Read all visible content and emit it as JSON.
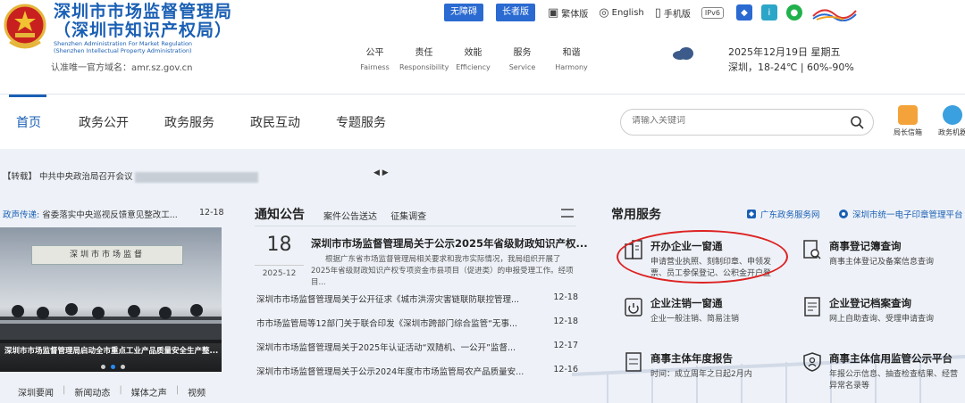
{
  "header": {
    "title_line1": "深圳市市场监督管理局",
    "title_line2": "（深圳市知识产权局）",
    "title_en_line1": "Shenzhen Administration For Market Regulation",
    "title_en_line2": "(Shenzhen Intellectual Property Administration)",
    "domain_label": "认准唯一官方域名：amr.sz.gov.cn",
    "values": [
      {
        "cn": "公平",
        "en": "Fairness"
      },
      {
        "cn": "责任",
        "en": "Responsibility"
      },
      {
        "cn": "效能",
        "en": "Efficiency"
      },
      {
        "cn": "服务",
        "en": "Service"
      },
      {
        "cn": "和谐",
        "en": "Harmony"
      }
    ],
    "date": "2025年12月19日 星期五",
    "weather": "深圳，18-24℃  |  60%-90%"
  },
  "topbar": {
    "accessible_label": "无障碍",
    "elderly_label": "长者版",
    "traditional_label": "繁体版",
    "english_label": "English",
    "mobile_label": "手机版",
    "ipv6_label": "IPv6"
  },
  "nav": {
    "items": [
      "首页",
      "政务公开",
      "政务服务",
      "政民互动",
      "专题服务"
    ],
    "search_placeholder": "请输入关键词",
    "icon1_label": "局长信箱",
    "icon2_label": "政务机器"
  },
  "ticker": {
    "text": "【转载】 中共中央政治局召开会议",
    "arrows": "◀ ▶"
  },
  "left": {
    "news_tag": "政声传递:",
    "news_title": "省委落实中央巡视反馈意见整改工...",
    "news_date": "12-18",
    "photo_sign": "深圳市市场监督",
    "photo_caption": "深圳市市场监督管理局启动全市重点工业产品质量安全生产整...",
    "tabs": [
      "深圳要闻",
      "新闻动态",
      "媒体之声",
      "视频"
    ]
  },
  "notice": {
    "heading": "通知公告",
    "tabs": [
      "案件公告送达",
      "征集调查"
    ],
    "featured": {
      "day": "18",
      "year_month": "2025-12",
      "title": "深圳市市场监督管理局关于公示2025年省级财政知识产权...",
      "summary": "根据广东省市场监督管理局相关要求和我市实际情况，我局组织开展了2025年省级财政知识产权专项资金市县项目（促进类）的申报受理工作。经项目..."
    },
    "items": [
      {
        "title": "深圳市市场监督管理局关于公开征求《城市洪涝灾害链联防联控管理...",
        "date": "12-18"
      },
      {
        "title": "市市场监管局等12部门关于联合印发《深圳市跨部门综合监管“无事...",
        "date": "12-18"
      },
      {
        "title": "深圳市市场监督管理局关于2025年认证活动“双随机、一公开”监督...",
        "date": "12-17"
      },
      {
        "title": "深圳市市场监督管理局关于公示2024年度市市场监管局农产品质量安...",
        "date": "12-16"
      }
    ]
  },
  "services": {
    "heading": "常用服务",
    "link1": "广东政务服务网",
    "link2": "深圳市统一电子印章管理平台",
    "items": [
      {
        "title": "开办企业一窗通",
        "desc1": "申请营业执照、刻制印章、申领发",
        "desc2": "票、员工参保登记、公积金开户登"
      },
      {
        "title": "商事登记簿查询",
        "desc1": "商事主体登记及备案信息查询",
        "desc2": ""
      },
      {
        "title": "企业注销一窗通",
        "desc1": "企业一般注销、简易注销",
        "desc2": ""
      },
      {
        "title": "企业登记档案查询",
        "desc1": "网上自助查询、受理申请查询",
        "desc2": ""
      },
      {
        "title": "商事主体年度报告",
        "desc1": "时间：成立周年之日起2月内",
        "desc2": ""
      },
      {
        "title": "商事主体信用监管公示平台",
        "desc1": "年报公示信息、抽查检查结果、经营",
        "desc2": "异常名录等"
      }
    ]
  },
  "colors": {
    "brand_blue": "#1a5fb4",
    "highlight_red": "#dd2222"
  }
}
